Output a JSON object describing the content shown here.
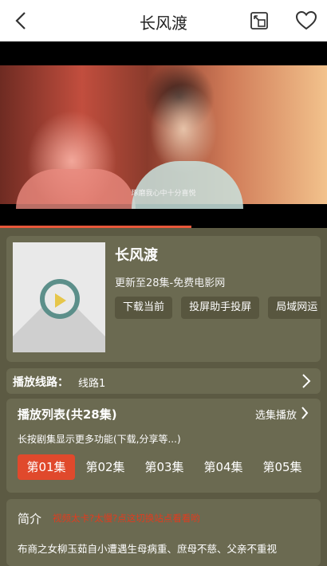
{
  "header": {
    "title": "长风渡",
    "back_icon": "chevron-left-icon",
    "cast_icon": "screen-cast-icon",
    "favorite_icon": "heart-icon"
  },
  "player": {
    "subtitle": "琢磨我心中十分喜悦",
    "progress": 0.585
  },
  "info": {
    "title": "长风渡",
    "update": "更新至28集-免费电影网",
    "buttons": [
      "下载当前",
      "投屏助手投屏",
      "局域网运"
    ]
  },
  "route": {
    "label": "播放线路：",
    "value": "线路1"
  },
  "playlist": {
    "title": "播放列表(共28集)",
    "select": "选集播放",
    "hint": "长按剧集显示更多功能(下载,分享等...)",
    "episodes": [
      "第01集",
      "第02集",
      "第03集",
      "第04集",
      "第05集"
    ],
    "active_index": 0
  },
  "intro": {
    "label": "简介",
    "tip": "视频太卡?太慢?点这切换站点看看哟",
    "text": "布商之女柳玉茹自小遭遇生母病重、庶母不慈、父亲不重视"
  },
  "colors": {
    "accent": "#e0492c",
    "panel": "#6b6a51",
    "background": "#5c5a43"
  }
}
